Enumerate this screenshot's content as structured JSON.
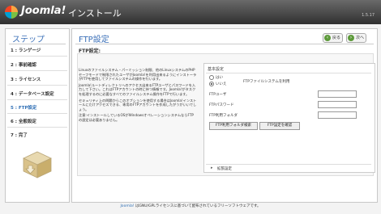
{
  "header": {
    "brand": "Joomla!",
    "title": "インストール",
    "version": "1.5.17"
  },
  "sidebar": {
    "title": "ステップ",
    "items": [
      {
        "label": "1 : ランゲージ",
        "active": false
      },
      {
        "label": "2 : 事前確認",
        "active": false
      },
      {
        "label": "3 : ライセンス",
        "active": false
      },
      {
        "label": "4 : データベース設定",
        "active": false
      },
      {
        "label": "5 : FTP設定",
        "active": true
      },
      {
        "label": "6 : 全般設定",
        "active": false
      },
      {
        "label": "7 : 完了",
        "active": false
      }
    ]
  },
  "main": {
    "title": "FTP設定",
    "back_label": "戻る",
    "next_label": "次へ",
    "section_title": "FTP設定:",
    "description": [
      "Linuxのファイルシステム・パーミッション制限、他のLinuxシステムのPHPセーフモードで制限されたユーザがJoomla!を利用出来るようにインストーラがFTPを使用してファイルシステムの操作を行います。",
      "Joomla!ルートディレクトリへのアクセス出来るFTPユーザとパスワードを入力して下さい。これはFTPアカウントの時に持つ情報です。Joomla!がタスクを処理するのに必要なすべてのファイルシステム操作をFTPで行います。",
      "セキュリティ上の問題からこのオプションを使用する場合はJoomla!インストールにだけアクセスできる、専用のFTPアカウントを作成したがうがいいでしょう。",
      "注意:インストールしているOSがWindowsオペレーションシステムならFTPの設定は必要ありません。"
    ],
    "basic": {
      "heading": "基本設定",
      "radio_no": "いいえ",
      "radio_yes": "はい",
      "use_ftp_label": "FTPファイルシステムを利用",
      "ftp_user_label": "FTPユーザ",
      "ftp_pass_label": "FTPパスワード",
      "ftp_root_label": "FTP利用フォルダ",
      "ftp_user_value": "",
      "ftp_pass_value": "",
      "ftp_root_value": "",
      "autofind_label": "FTP利用フォルダ検索",
      "verify_label": "FTP設定を確認",
      "advanced_label": "拡張設定"
    }
  },
  "footer": {
    "link_text": "Joomla!",
    "text": " はGNU/GPLライセンスに基づいて配布されているフリーソフトウェアです。"
  }
}
